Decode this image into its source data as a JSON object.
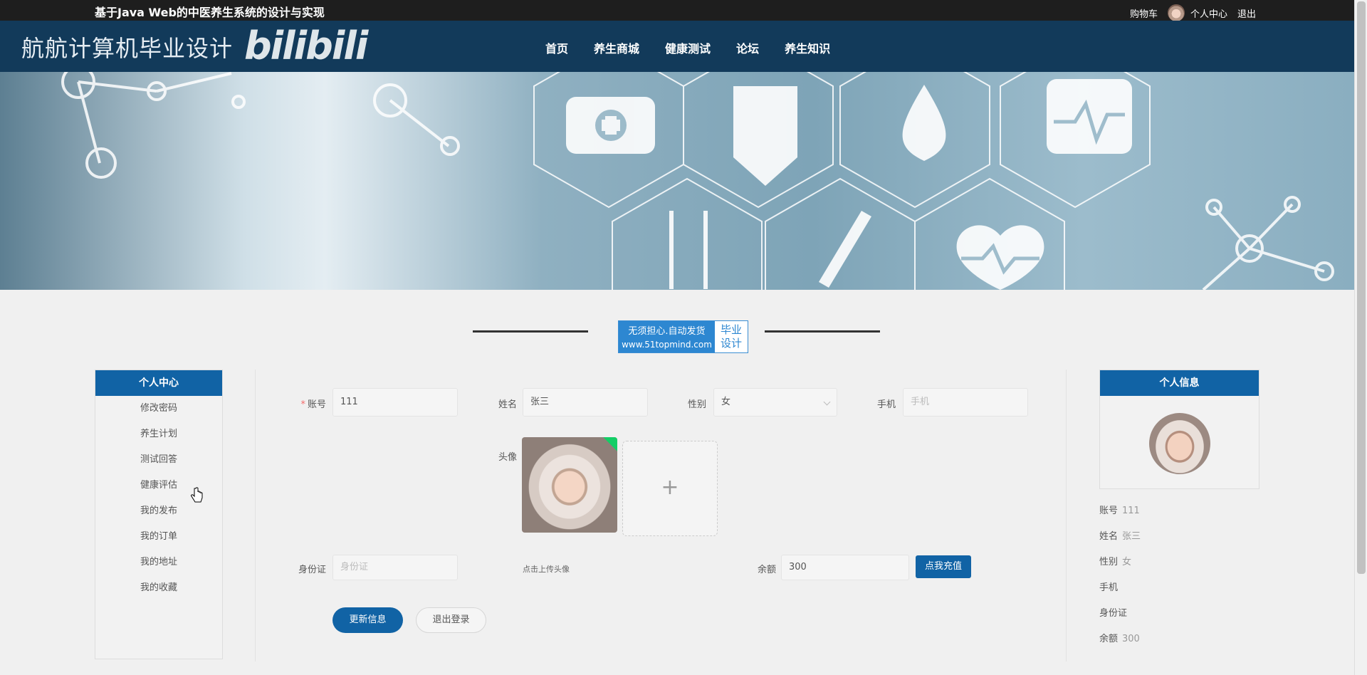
{
  "topbar": {
    "title": "基于Java Web的中医养生系统的设计与实现",
    "cart": "购物车",
    "profile": "个人中心",
    "logout": "退出"
  },
  "navbar": {
    "brand": "航航计算机毕业设计",
    "logo": "bilibili",
    "menu": [
      "首页",
      "养生商城",
      "健康测试",
      "论坛",
      "养生知识"
    ]
  },
  "banner": {
    "slides": 3,
    "active_slide": 3
  },
  "promo": {
    "line1": "无须担心.自动发货",
    "url": "www.51topmind.com",
    "tag1": "毕业",
    "tag2": "设计"
  },
  "sidebar": {
    "title": "个人中心",
    "items": [
      "修改密码",
      "养生计划",
      "测试回答",
      "健康评估",
      "我的发布",
      "我的订单",
      "我的地址",
      "我的收藏"
    ]
  },
  "form": {
    "account_label": "账号",
    "account_required": "*",
    "account_value": "111",
    "name_label": "姓名",
    "name_value": "张三",
    "gender_label": "性别",
    "gender_value": "女",
    "phone_label": "手机",
    "phone_placeholder": "手机",
    "avatar_label": "头像",
    "upload_plus": "+",
    "upload_hint": "点击上传头像",
    "idcard_label": "身份证",
    "idcard_placeholder": "身份证",
    "balance_label": "余额",
    "balance_value": "300",
    "recharge_button": "点我充值",
    "update_button": "更新信息",
    "logout_button": "退出登录"
  },
  "info_panel": {
    "title": "个人信息",
    "rows": [
      {
        "label": "账号",
        "value": "111"
      },
      {
        "label": "姓名",
        "value": "张三"
      },
      {
        "label": "性别",
        "value": "女"
      },
      {
        "label": "手机",
        "value": ""
      },
      {
        "label": "身份证",
        "value": ""
      },
      {
        "label": "余额",
        "value": "300"
      }
    ]
  },
  "colors": {
    "topbar": "#1e1e1e",
    "navbar": "#123a5a",
    "primary": "#1163a5",
    "dot_active": "#e0342f"
  }
}
